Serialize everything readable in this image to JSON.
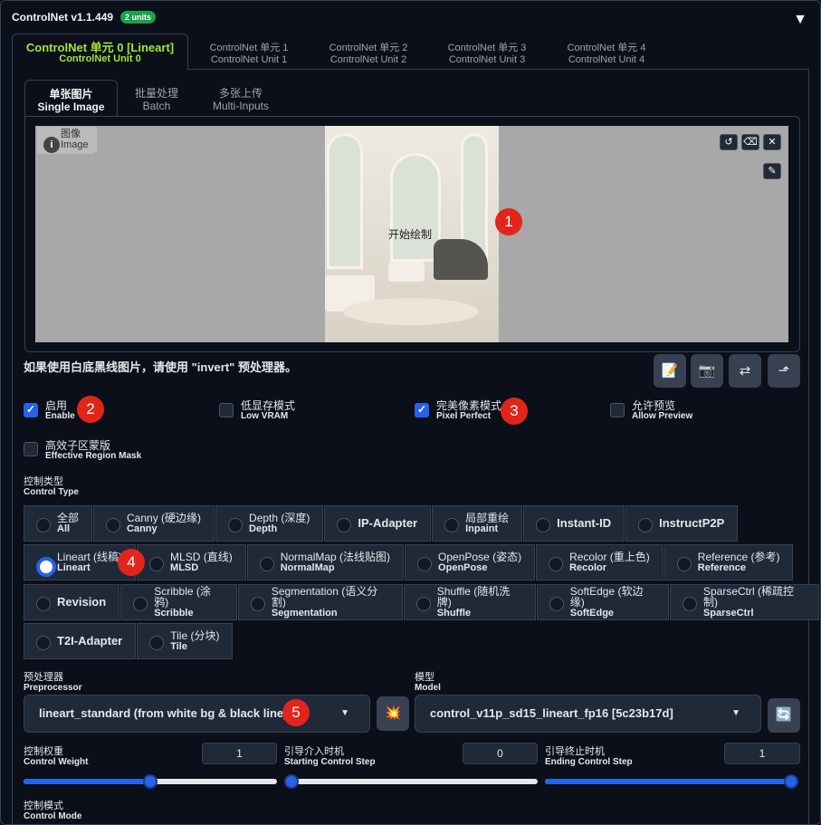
{
  "header": {
    "title": "ControlNet v1.1.449",
    "badge": "2 units",
    "collapse_icon": "▼"
  },
  "unit_tabs": [
    {
      "zh": "ControlNet 单元 0 [Lineart]",
      "en": "ControlNet Unit 0"
    },
    {
      "zh": "ControlNet 单元 1",
      "en": "ControlNet Unit 1"
    },
    {
      "zh": "ControlNet 单元 2",
      "en": "ControlNet Unit 2"
    },
    {
      "zh": "ControlNet 单元 3",
      "en": "ControlNet Unit 3"
    },
    {
      "zh": "ControlNet 单元 4",
      "en": "ControlNet Unit 4"
    }
  ],
  "image_tabs": [
    {
      "zh": "单张图片",
      "en": "Single Image"
    },
    {
      "zh": "批量处理",
      "en": "Batch"
    },
    {
      "zh": "多张上传",
      "en": "Multi-Inputs"
    }
  ],
  "canvas": {
    "label_zh": "图像",
    "label_en": "Image",
    "start_draw": "开始绘制",
    "info": "i"
  },
  "hint": "如果使用白底黑线图片，请使用 \"invert\" 预处理器。",
  "markers": [
    "1",
    "2",
    "3",
    "4",
    "5"
  ],
  "checkboxes": {
    "enable": {
      "zh": "启用",
      "en": "Enable",
      "checked": true
    },
    "low_vram": {
      "zh": "低显存模式",
      "en": "Low VRAM",
      "checked": false
    },
    "pixel_perfect": {
      "zh": "完美像素模式",
      "en": "Pixel Perfect",
      "checked": true
    },
    "allow_preview": {
      "zh": "允许预览",
      "en": "Allow Preview",
      "checked": false
    },
    "region_mask": {
      "zh": "高效子区蒙版",
      "en": "Effective Region Mask",
      "checked": false
    }
  },
  "control_type": {
    "label_zh": "控制类型",
    "label_en": "Control Type",
    "selected": "Lineart",
    "rows": [
      [
        {
          "zh": "全部",
          "en": "All"
        },
        {
          "zh": "Canny (硬边缘)",
          "en": "Canny"
        },
        {
          "zh": "Depth (深度)",
          "en": "Depth"
        },
        {
          "single": "IP-Adapter"
        },
        {
          "zh": "局部重绘",
          "en": "Inpaint"
        },
        {
          "single": "Instant-ID"
        },
        {
          "single": "InstructP2P"
        }
      ],
      [
        {
          "zh": "Lineart (线稿)",
          "en": "Lineart"
        },
        {
          "zh": "MLSD (直线)",
          "en": "MLSD"
        },
        {
          "zh": "NormalMap (法线贴图)",
          "en": "NormalMap"
        },
        {
          "zh": "OpenPose (姿态)",
          "en": "OpenPose"
        },
        {
          "zh": "Recolor (重上色)",
          "en": "Recolor"
        },
        {
          "zh": "Reference (参考)",
          "en": "Reference"
        }
      ],
      [
        {
          "single": "Revision"
        },
        {
          "zh": "Scribble (涂鸦)",
          "en": "Scribble"
        },
        {
          "zh": "Segmentation (语义分割)",
          "en": "Segmentation"
        },
        {
          "zh": "Shuffle (随机洗牌)",
          "en": "Shuffle"
        },
        {
          "zh": "SoftEdge (软边缘)",
          "en": "SoftEdge"
        },
        {
          "zh": "SparseCtrl (稀疏控制)",
          "en": "SparseCtrl"
        }
      ],
      [
        {
          "single": "T2I-Adapter"
        },
        {
          "zh": "Tile (分块)",
          "en": "Tile"
        }
      ]
    ]
  },
  "preprocessor": {
    "label_zh": "预处理器",
    "label_en": "Preprocessor",
    "value": "lineart_standard (from white bg & black line)"
  },
  "model": {
    "label_zh": "模型",
    "label_en": "Model",
    "value": "control_v11p_sd15_lineart_fp16 [5c23b17d]"
  },
  "sliders": {
    "weight": {
      "zh": "控制权重",
      "en": "Control Weight",
      "value": "1",
      "fraction": 0.5
    },
    "start": {
      "zh": "引导介入时机",
      "en": "Starting Control Step",
      "value": "0",
      "fraction": 0
    },
    "end": {
      "zh": "引导终止时机",
      "en": "Ending Control Step",
      "value": "1",
      "fraction": 1
    }
  },
  "control_mode": {
    "label_zh": "控制模式",
    "label_en": "Control Mode"
  }
}
